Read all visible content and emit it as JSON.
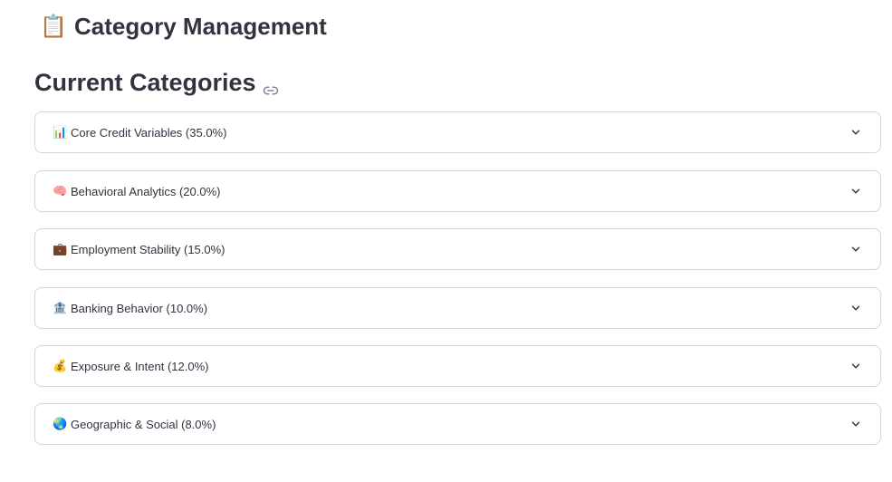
{
  "header": {
    "title_icon": "clipboard-icon",
    "title_emoji": "📋",
    "title": "Category Management"
  },
  "section": {
    "heading": "Current Categories",
    "anchor_icon": "link-icon"
  },
  "categories": [
    {
      "icon": "bar-chart-icon",
      "emoji": "📊",
      "label": "Core Credit Variables (35.0%)"
    },
    {
      "icon": "brain-icon",
      "emoji": "🧠",
      "label": "Behavioral Analytics (20.0%)"
    },
    {
      "icon": "briefcase-icon",
      "emoji": "💼",
      "label": "Employment Stability (15.0%)"
    },
    {
      "icon": "bank-icon",
      "emoji": "🏦",
      "label": "Banking Behavior (10.0%)"
    },
    {
      "icon": "money-bag-icon",
      "emoji": "💰",
      "label": "Exposure & Intent (12.0%)"
    },
    {
      "icon": "globe-icon",
      "emoji": "🌏",
      "label": "Geographic & Social (8.0%)"
    }
  ]
}
